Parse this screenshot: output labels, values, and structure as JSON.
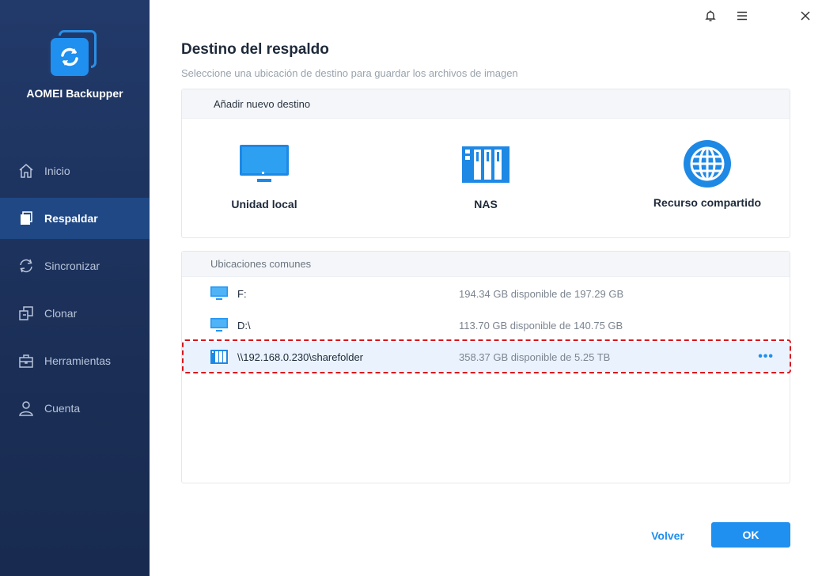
{
  "app": {
    "name": "AOMEI Backupper"
  },
  "nav": [
    {
      "label": "Inicio",
      "icon": "home-icon"
    },
    {
      "label": "Respaldar",
      "icon": "backup-icon",
      "active": true
    },
    {
      "label": "Sincronizar",
      "icon": "sync-icon"
    },
    {
      "label": "Clonar",
      "icon": "clone-icon"
    },
    {
      "label": "Herramientas",
      "icon": "toolbox-icon"
    },
    {
      "label": "Cuenta",
      "icon": "user-icon"
    }
  ],
  "window_controls": [
    "bell-icon",
    "menu-icon",
    "close-icon"
  ],
  "page": {
    "title": "Destino del respaldo",
    "subtitle": "Seleccione una ubicación de destino para guardar los archivos de imagen"
  },
  "add_destination": {
    "header": "Añadir nuevo destino",
    "options": [
      {
        "label": "Unidad local",
        "icon": "monitor-icon"
      },
      {
        "label": "NAS",
        "icon": "nas-icon"
      },
      {
        "label": "Recurso compartido",
        "icon": "globe-icon"
      }
    ]
  },
  "common": {
    "header": "Ubicaciones comunes",
    "rows": [
      {
        "name": "F:",
        "free": "194.34 GB disponible de 197.29 GB",
        "icon": "drive-icon"
      },
      {
        "name": "D:\\",
        "free": "113.70 GB disponible de 140.75 GB",
        "icon": "drive-icon"
      },
      {
        "name": "\\\\192.168.0.230\\sharefolder",
        "free": "358.37 GB disponible de 5.25 TB",
        "icon": "nas-icon",
        "selected": true,
        "more": "•••"
      }
    ]
  },
  "footer": {
    "back": "Volver",
    "ok": "OK"
  },
  "colors": {
    "accent": "#1f8ff0",
    "sidebar": "#1b2f57",
    "highlight": "#d9141b"
  }
}
